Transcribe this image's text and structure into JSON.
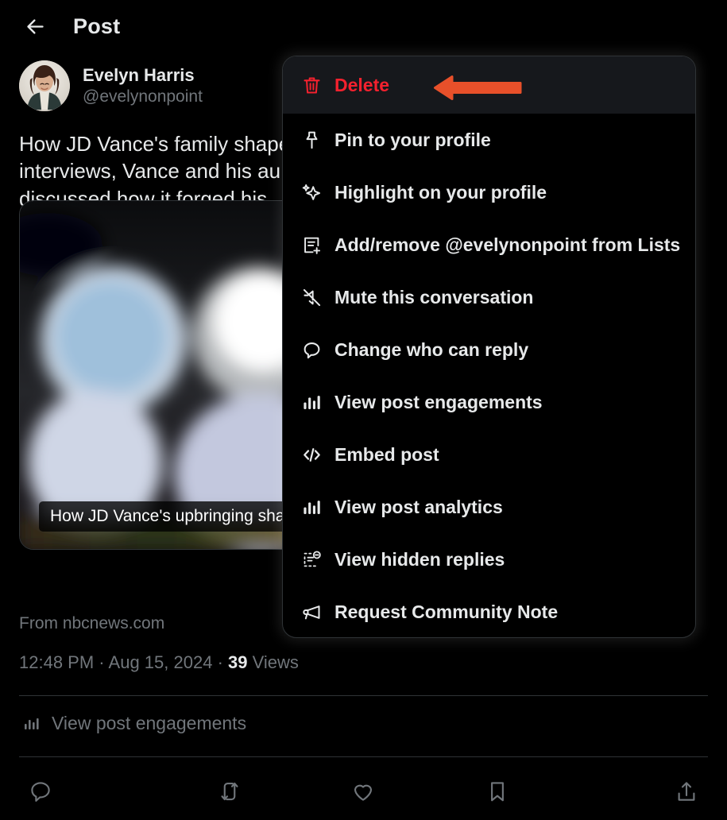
{
  "header": {
    "title": "Post",
    "back_icon": "arrow-left-icon"
  },
  "post": {
    "display_name": "Evelyn Harris",
    "handle": "@evelynonpoint",
    "avatar_icon": "user-avatar",
    "text": "How JD Vance's family shaped\ninterviews, Vance and his au\ndiscussed how it forged his \nand children.",
    "media": {
      "caption": "How JD Vance's upbringing shape",
      "source": "From nbcnews.com"
    },
    "meta": {
      "time": "12:48 PM",
      "separator": "·",
      "date": "Aug 15, 2024",
      "views_count": "39",
      "views_label": "Views"
    },
    "engagements": {
      "icon": "bar-chart-icon",
      "label": "View post engagements"
    }
  },
  "action_bar": [
    {
      "name": "reply-button",
      "icon": "comment-icon"
    },
    {
      "name": "repost-button",
      "icon": "repost-icon"
    },
    {
      "name": "like-button",
      "icon": "heart-icon"
    },
    {
      "name": "bookmark-button",
      "icon": "bookmark-icon"
    },
    {
      "name": "share-button",
      "icon": "share-icon"
    }
  ],
  "menu": {
    "items": [
      {
        "label": "Delete",
        "icon": "trash-icon",
        "danger": true
      },
      {
        "label": "Pin to your profile",
        "icon": "pin-icon"
      },
      {
        "label": "Highlight on your profile",
        "icon": "sparkle-icon"
      },
      {
        "label": "Add/remove @evelynonpoint from Lists",
        "icon": "list-add-icon"
      },
      {
        "label": "Mute this conversation",
        "icon": "mute-icon"
      },
      {
        "label": "Change who can reply",
        "icon": "speech-bubble-icon"
      },
      {
        "label": "View post engagements",
        "icon": "bar-chart-icon"
      },
      {
        "label": "Embed post",
        "icon": "code-icon"
      },
      {
        "label": "View post analytics",
        "icon": "bar-chart-icon"
      },
      {
        "label": "View hidden replies",
        "icon": "hidden-replies-icon"
      },
      {
        "label": "Request Community Note",
        "icon": "megaphone-icon"
      }
    ]
  },
  "annotation": {
    "arrow": "left-pointing-arrow",
    "arrow_color": "#e8502a",
    "points_to": "Delete"
  },
  "colors": {
    "background": "#000000",
    "text_primary": "#e7e9ea",
    "text_secondary": "#71767b",
    "danger": "#f4212e",
    "border": "#2f3336",
    "menu_highlight": "#16181c"
  }
}
